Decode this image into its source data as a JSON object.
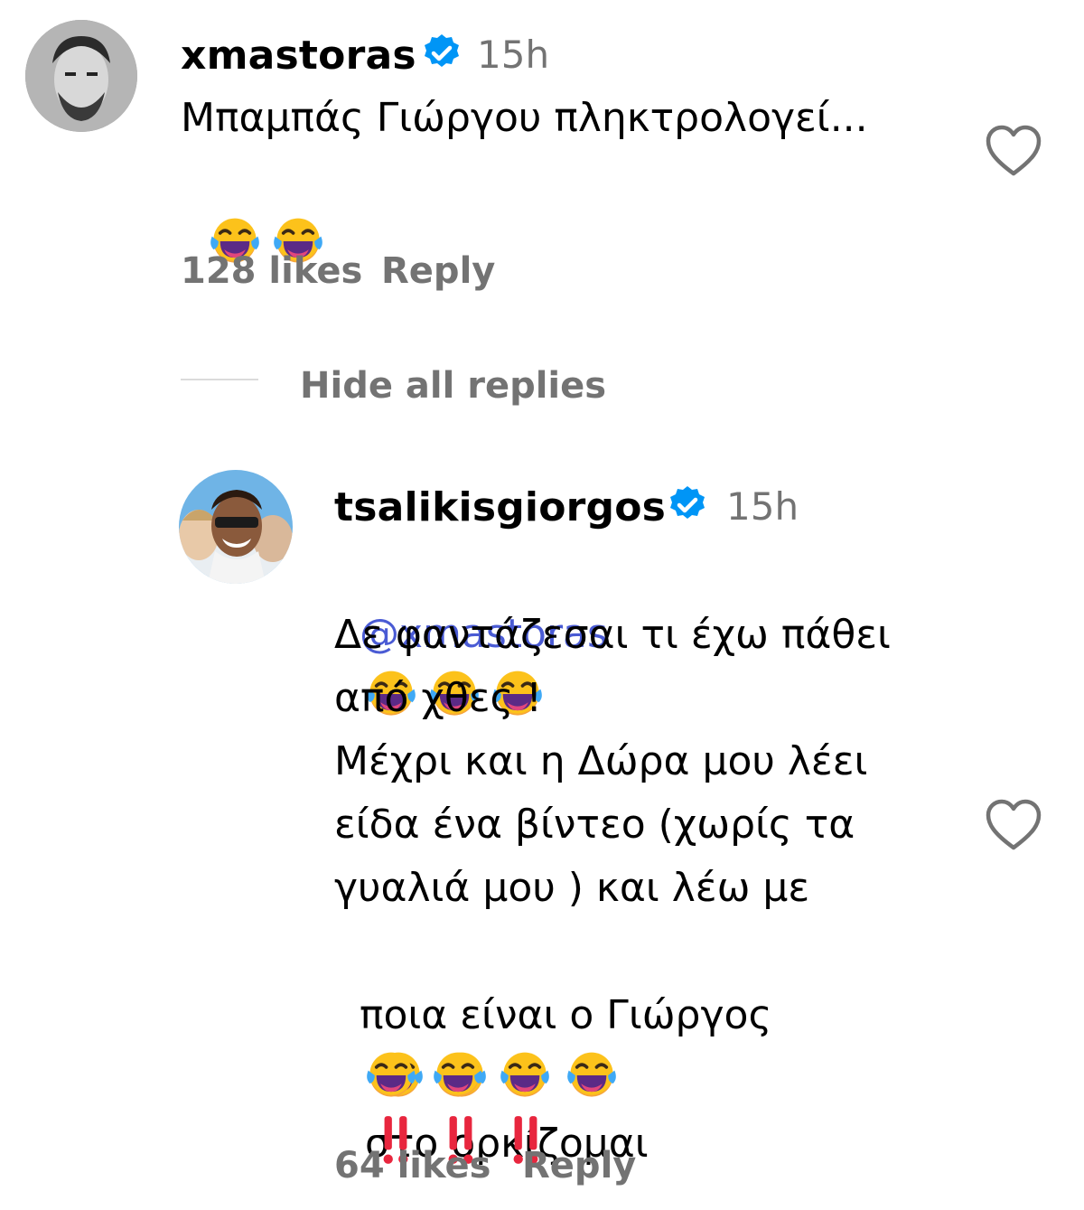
{
  "comment": {
    "username": "xmastoras",
    "time": "15h",
    "text": "Μπαμπάς Γιώργου πληκτρολογεί...",
    "emoji": "😂😂",
    "likes": "128 likes",
    "reply": "Reply"
  },
  "replies_toggle": "Hide all replies",
  "reply": {
    "username": "tsalikisgiorgos",
    "time": "15h",
    "mention": "@xmastoras",
    "line_mention_emoji": "😂😂😂",
    "lines": [
      "Δε φαντάζεσαι τι έχω πάθει",
      "από χθες !",
      "Μέχρι και η Δώρα μου λέει",
      "είδα ένα βίντεο (χωρίς τα",
      "γυαλιά μου ) και λέω με",
      "ποια είναι ο Γιώργος"
    ],
    "line7_emoji": "😂😂😂😂",
    "line7_text": "στο ορκίζομαι",
    "bangs": "‼‼‼",
    "likes": "64 likes",
    "reply": "Reply"
  },
  "colors": {
    "secondary_text": "#737373",
    "mention": "#4a5bd4",
    "verified": "#0095f6",
    "divider": "#dbdbdb"
  },
  "icons": [
    "verified-badge-icon",
    "heart-outline-icon",
    "tears-of-joy-emoji",
    "double-exclamation-emoji"
  ]
}
